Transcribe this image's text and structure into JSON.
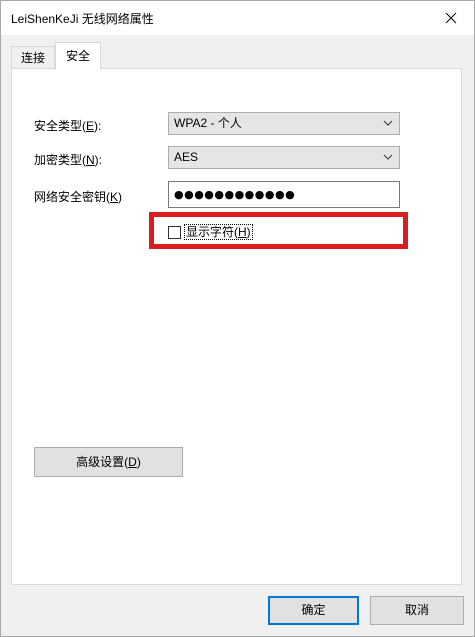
{
  "window": {
    "title": "LeiShenKeJi 无线网络属性"
  },
  "tabs": [
    {
      "label": "连接",
      "active": false
    },
    {
      "label": "安全",
      "active": true
    }
  ],
  "security": {
    "security_type": {
      "label": "安全类型(",
      "hotkey": "E",
      "label_end": "):",
      "value": "WPA2 - 个人"
    },
    "encryption_type": {
      "label": "加密类型(",
      "hotkey": "N",
      "label_end": "):",
      "value": "AES"
    },
    "network_key": {
      "label": "网络安全密钥(",
      "hotkey": "K",
      "label_end": ")",
      "value": "●●●●●●●●●●●●"
    },
    "show_characters": {
      "label": "显示字符(",
      "hotkey": "H",
      "label_end": ")",
      "checked": false
    },
    "advanced_button": {
      "label": "高级设置(",
      "hotkey": "D",
      "label_end": ")"
    }
  },
  "footer": {
    "ok_label": "确定",
    "cancel_label": "取消"
  },
  "colors": {
    "highlight": "#d81e1e",
    "focus_border": "#0078d7"
  },
  "icons": {
    "close": "close-icon",
    "dropdown": "chevron-down-icon"
  }
}
